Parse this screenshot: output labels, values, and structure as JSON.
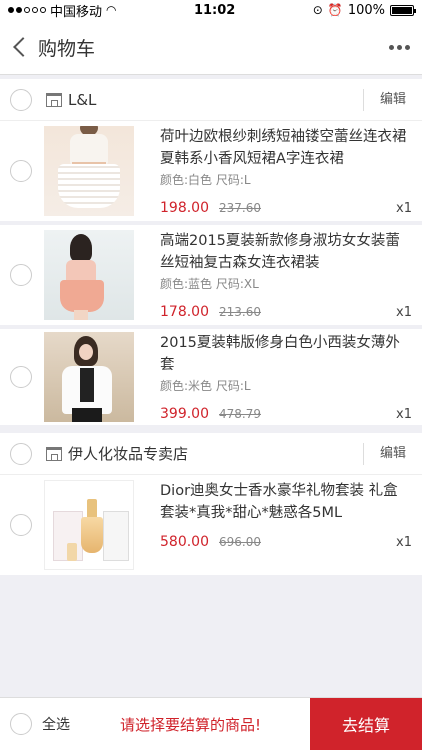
{
  "status_bar": {
    "carrier": "中国移动",
    "time": "11:02",
    "battery": "100%",
    "battery_level": 1.0
  },
  "nav": {
    "title": "购物车"
  },
  "stores": [
    {
      "name": "L&L",
      "edit_label": "编辑",
      "items": [
        {
          "title": "荷叶边欧根纱刺绣短袖镂空蕾丝连衣裙 夏韩系小香风短裙A字连衣裙",
          "spec": "颜色:白色 尺码:L",
          "price": "198.00",
          "old_price": "237.60",
          "qty": "x1",
          "image": "dress-white-photo"
        },
        {
          "title": "高端2015夏装新款修身淑坊女女装蕾丝短袖复古森女连衣裙装",
          "spec": "颜色:蓝色 尺码:XL",
          "price": "178.00",
          "old_price": "213.60",
          "qty": "x1",
          "image": "dress-pink-photo"
        },
        {
          "title": "2015夏装韩版修身白色小西装女薄外套",
          "spec": "颜色:米色 尺码:L",
          "price": "399.00",
          "old_price": "478.79",
          "qty": "x1",
          "image": "white-jacket-photo"
        }
      ]
    },
    {
      "name": "伊人化妆品专卖店",
      "edit_label": "编辑",
      "items": [
        {
          "title": "Dior迪奥女士香水豪华礼物套装 礼盒套装*真我*甜心*魅惑各5ML",
          "price": "580.00",
          "old_price": "696.00",
          "qty": "x1",
          "image": "perfume-gift-set-photo"
        }
      ]
    }
  ],
  "footer": {
    "select_all_label": "全选",
    "message": "请选择要结算的商品!",
    "checkout_label": "去结算"
  },
  "colors": {
    "accent": "#d0232b",
    "background": "#efeff4"
  }
}
